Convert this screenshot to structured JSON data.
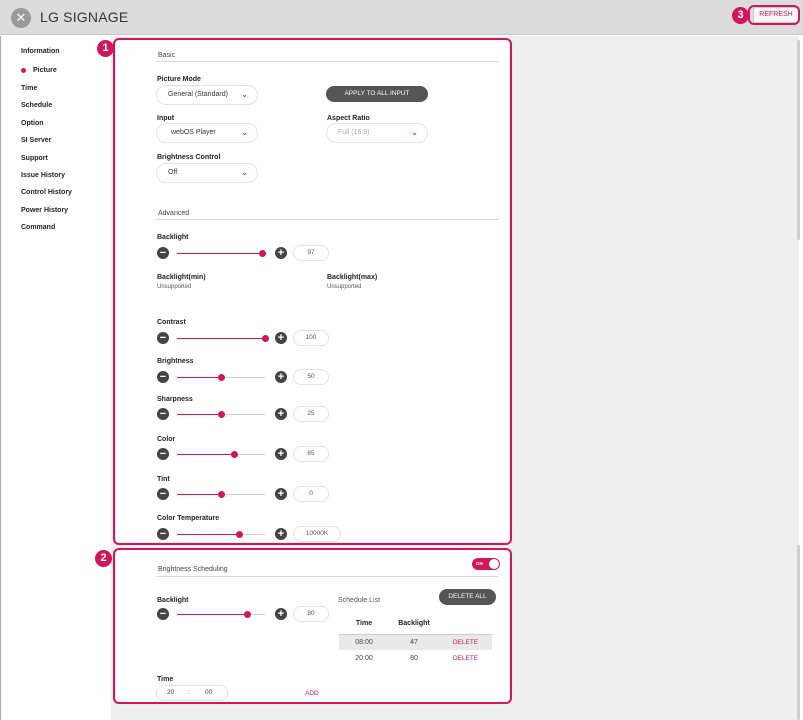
{
  "app": {
    "title": "LG SIGNAGE",
    "refresh_label": "REFRESH"
  },
  "badges": [
    "1",
    "2",
    "3"
  ],
  "sidebar": {
    "items": [
      {
        "label": "Information",
        "active": false
      },
      {
        "label": "Picture",
        "active": true
      },
      {
        "label": "Time",
        "active": false
      },
      {
        "label": "Schedule",
        "active": false
      },
      {
        "label": "Option",
        "active": false
      },
      {
        "label": "SI Server",
        "active": false
      },
      {
        "label": "Support",
        "active": false
      },
      {
        "label": "Issue History",
        "active": false
      },
      {
        "label": "Control History",
        "active": false
      },
      {
        "label": "Power History",
        "active": false
      },
      {
        "label": "Command",
        "active": false
      }
    ]
  },
  "basic": {
    "header": "Basic",
    "picture_mode": {
      "label": "Picture Mode",
      "value": "General (Standard)"
    },
    "apply_button": "APPLY TO ALL INPUT",
    "input": {
      "label": "Input",
      "value": "webOS Player"
    },
    "aspect_ratio": {
      "label": "Aspect Ratio",
      "value": "Full (16:9)"
    },
    "brightness_control": {
      "label": "Brightness Control",
      "value": "Off"
    }
  },
  "advanced": {
    "header": "Advanced",
    "backlight_min": {
      "label": "Backlight(min)",
      "value": "Unsupported"
    },
    "backlight_max": {
      "label": "Backlight(max)",
      "value": "Unsupported"
    },
    "sliders": [
      {
        "key": "backlight",
        "label": "Backlight",
        "value": "97",
        "fraction": 0.97
      },
      {
        "key": "contrast",
        "label": "Contrast",
        "value": "100",
        "fraction": 1.0
      },
      {
        "key": "brightness",
        "label": "Brightness",
        "value": "50",
        "fraction": 0.5
      },
      {
        "key": "sharpness",
        "label": "Sharpness",
        "value": "25",
        "fraction": 0.5
      },
      {
        "key": "color",
        "label": "Color",
        "value": "65",
        "fraction": 0.65
      },
      {
        "key": "tint",
        "label": "Tint",
        "value": "0",
        "fraction": 0.5
      },
      {
        "key": "color-temperature",
        "label": "Color Temperature",
        "value": "10000K",
        "fraction": 0.7
      }
    ]
  },
  "scheduling": {
    "header": "Brightness Scheduling",
    "toggle_label": "ON",
    "backlight": {
      "label": "Backlight",
      "value": "80",
      "fraction": 0.8
    },
    "schedule_list_label": "Schedule List",
    "delete_all_label": "DELETE ALL",
    "table": {
      "columns": [
        "Time",
        "Backlight"
      ],
      "rows": [
        {
          "time": "08:00",
          "backlight": "47",
          "action": "DELETE"
        },
        {
          "time": "20:00",
          "backlight": "80",
          "action": "DELETE"
        }
      ]
    },
    "time_label": "Time",
    "time_hour": "20",
    "time_separator": ":",
    "time_minute": "00",
    "add_label": "ADD"
  },
  "colors": {
    "accent": "#d0175a",
    "dark_button": "#555555",
    "background": "#efefef"
  }
}
